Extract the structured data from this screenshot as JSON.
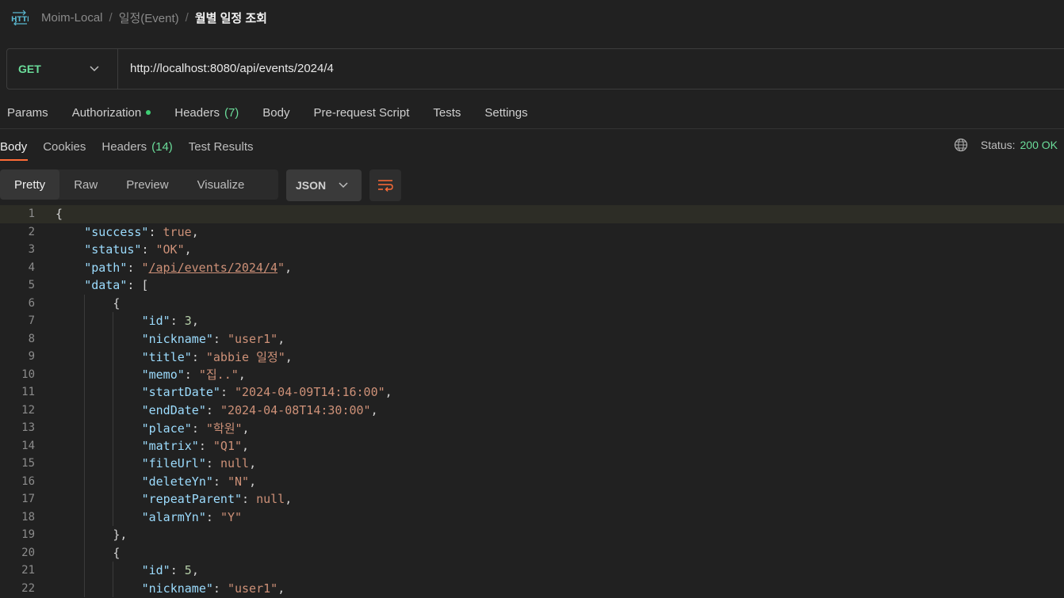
{
  "breadcrumb": {
    "icon": "http-icon",
    "items": [
      "Moim-Local",
      "일정(Event)"
    ],
    "current": "월별 일정 조회"
  },
  "request": {
    "method": "GET",
    "url": "http://localhost:8080/api/events/2024/4"
  },
  "request_tabs": [
    {
      "label": "Params"
    },
    {
      "label": "Authorization",
      "dot": true
    },
    {
      "label": "Headers",
      "count": "(7)"
    },
    {
      "label": "Body"
    },
    {
      "label": "Pre-request Script"
    },
    {
      "label": "Tests"
    },
    {
      "label": "Settings"
    }
  ],
  "response_tabs": [
    {
      "label": "Body",
      "active": true
    },
    {
      "label": "Cookies"
    },
    {
      "label": "Headers",
      "count": "(14)"
    },
    {
      "label": "Test Results"
    }
  ],
  "status": {
    "label": "Status:",
    "value": "200 OK"
  },
  "view_tabs": [
    "Pretty",
    "Raw",
    "Preview",
    "Visualize"
  ],
  "active_view": "Pretty",
  "format": "JSON",
  "colors": {
    "accent": "#ff6c37",
    "success": "#6bdd9a",
    "key": "#9cdcfe",
    "string": "#ce9178",
    "number": "#b5cea8"
  },
  "code_lines": [
    {
      "n": "1",
      "indent": 0,
      "parts": [
        [
          "p",
          "{"
        ]
      ]
    },
    {
      "n": "2",
      "indent": 1,
      "parts": [
        [
          "k",
          "\"success\""
        ],
        [
          "p",
          ": "
        ],
        [
          "b",
          "true"
        ],
        [
          "p",
          ","
        ]
      ]
    },
    {
      "n": "3",
      "indent": 1,
      "parts": [
        [
          "k",
          "\"status\""
        ],
        [
          "p",
          ": "
        ],
        [
          "s",
          "\"OK\""
        ],
        [
          "p",
          ","
        ]
      ]
    },
    {
      "n": "4",
      "indent": 1,
      "parts": [
        [
          "k",
          "\"path\""
        ],
        [
          "p",
          ": "
        ],
        [
          "s",
          "\""
        ],
        [
          "u",
          "/api/events/2024/4"
        ],
        [
          "s",
          "\""
        ],
        [
          "p",
          ","
        ]
      ]
    },
    {
      "n": "5",
      "indent": 1,
      "parts": [
        [
          "k",
          "\"data\""
        ],
        [
          "p",
          ": ["
        ]
      ]
    },
    {
      "n": "6",
      "indent": 2,
      "parts": [
        [
          "p",
          "{"
        ]
      ]
    },
    {
      "n": "7",
      "indent": 3,
      "parts": [
        [
          "k",
          "\"id\""
        ],
        [
          "p",
          ": "
        ],
        [
          "n",
          "3"
        ],
        [
          "p",
          ","
        ]
      ]
    },
    {
      "n": "8",
      "indent": 3,
      "parts": [
        [
          "k",
          "\"nickname\""
        ],
        [
          "p",
          ": "
        ],
        [
          "s",
          "\"user1\""
        ],
        [
          "p",
          ","
        ]
      ]
    },
    {
      "n": "9",
      "indent": 3,
      "parts": [
        [
          "k",
          "\"title\""
        ],
        [
          "p",
          ": "
        ],
        [
          "s",
          "\"abbie 일정\""
        ],
        [
          "p",
          ","
        ]
      ]
    },
    {
      "n": "10",
      "indent": 3,
      "parts": [
        [
          "k",
          "\"memo\""
        ],
        [
          "p",
          ": "
        ],
        [
          "s",
          "\"집..\""
        ],
        [
          "p",
          ","
        ]
      ]
    },
    {
      "n": "11",
      "indent": 3,
      "parts": [
        [
          "k",
          "\"startDate\""
        ],
        [
          "p",
          ": "
        ],
        [
          "s",
          "\"2024-04-09T14:16:00\""
        ],
        [
          "p",
          ","
        ]
      ]
    },
    {
      "n": "12",
      "indent": 3,
      "parts": [
        [
          "k",
          "\"endDate\""
        ],
        [
          "p",
          ": "
        ],
        [
          "s",
          "\"2024-04-08T14:30:00\""
        ],
        [
          "p",
          ","
        ]
      ]
    },
    {
      "n": "13",
      "indent": 3,
      "parts": [
        [
          "k",
          "\"place\""
        ],
        [
          "p",
          ": "
        ],
        [
          "s",
          "\"학원\""
        ],
        [
          "p",
          ","
        ]
      ]
    },
    {
      "n": "14",
      "indent": 3,
      "parts": [
        [
          "k",
          "\"matrix\""
        ],
        [
          "p",
          ": "
        ],
        [
          "s",
          "\"Q1\""
        ],
        [
          "p",
          ","
        ]
      ]
    },
    {
      "n": "15",
      "indent": 3,
      "parts": [
        [
          "k",
          "\"fileUrl\""
        ],
        [
          "p",
          ": "
        ],
        [
          "b",
          "null"
        ],
        [
          "p",
          ","
        ]
      ]
    },
    {
      "n": "16",
      "indent": 3,
      "parts": [
        [
          "k",
          "\"deleteYn\""
        ],
        [
          "p",
          ": "
        ],
        [
          "s",
          "\"N\""
        ],
        [
          "p",
          ","
        ]
      ]
    },
    {
      "n": "17",
      "indent": 3,
      "parts": [
        [
          "k",
          "\"repeatParent\""
        ],
        [
          "p",
          ": "
        ],
        [
          "b",
          "null"
        ],
        [
          "p",
          ","
        ]
      ]
    },
    {
      "n": "18",
      "indent": 3,
      "parts": [
        [
          "k",
          "\"alarmYn\""
        ],
        [
          "p",
          ": "
        ],
        [
          "s",
          "\"Y\""
        ]
      ]
    },
    {
      "n": "19",
      "indent": 2,
      "parts": [
        [
          "p",
          "},"
        ]
      ]
    },
    {
      "n": "20",
      "indent": 2,
      "parts": [
        [
          "p",
          "{"
        ]
      ]
    },
    {
      "n": "21",
      "indent": 3,
      "parts": [
        [
          "k",
          "\"id\""
        ],
        [
          "p",
          ": "
        ],
        [
          "n",
          "5"
        ],
        [
          "p",
          ","
        ]
      ]
    },
    {
      "n": "22",
      "indent": 3,
      "parts": [
        [
          "k",
          "\"nickname\""
        ],
        [
          "p",
          ": "
        ],
        [
          "s",
          "\"user1\""
        ],
        [
          "p",
          ","
        ]
      ]
    }
  ]
}
